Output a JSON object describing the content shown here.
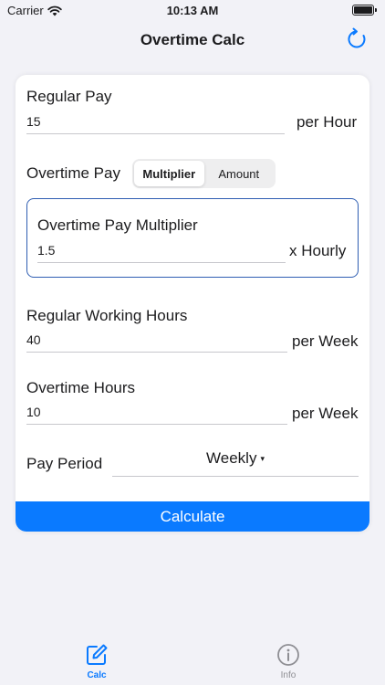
{
  "status": {
    "carrier": "Carrier",
    "time": "10:13 AM"
  },
  "nav": {
    "title": "Overtime Calc"
  },
  "form": {
    "regular_pay": {
      "label": "Regular Pay",
      "value": "15",
      "unit": "per Hour"
    },
    "overtime_pay": {
      "label": "Overtime Pay",
      "segments": [
        "Multiplier",
        "Amount"
      ],
      "selected": "Multiplier"
    },
    "multiplier": {
      "label": "Overtime Pay Multiplier",
      "value": "1.5",
      "unit": "x Hourly"
    },
    "regular_hours": {
      "label": "Regular Working Hours",
      "value": "40",
      "unit": "per Week"
    },
    "overtime_hours": {
      "label": "Overtime Hours",
      "value": "10",
      "unit": "per Week"
    },
    "pay_period": {
      "label": "Pay Period",
      "value": "Weekly",
      "arrow": "▾"
    },
    "calculate_label": "Calculate"
  },
  "tabs": [
    {
      "label": "Calc",
      "icon": "edit-icon",
      "active": true
    },
    {
      "label": "Info",
      "icon": "info-icon",
      "active": false
    }
  ],
  "colors": {
    "accent": "#0a7aff",
    "box_border": "#2f5eb2",
    "background": "#f2f2f7"
  }
}
